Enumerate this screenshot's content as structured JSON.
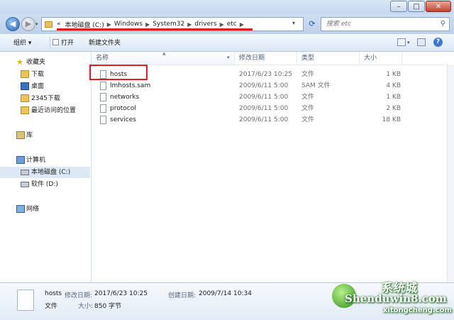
{
  "address": {
    "overflow": "«",
    "segments": [
      "本地磁盘 (C:)",
      "Windows",
      "System32",
      "drivers",
      "etc"
    ]
  },
  "search": {
    "placeholder": "搜索 etc"
  },
  "toolbar": {
    "organize": "组织 ▾",
    "open": "打开",
    "new_folder": "新建文件夹"
  },
  "nav": {
    "favorites": "收藏夹",
    "fav_items": [
      "下载",
      "桌面",
      "2345下载",
      "最近访问的位置"
    ],
    "library": "库",
    "computer": "计算机",
    "drives": [
      "本地磁盘 (C:)",
      "软件 (D:)"
    ],
    "network": "网络"
  },
  "columns": {
    "name": "名称",
    "date": "修改日期",
    "type": "类型",
    "size": "大小"
  },
  "files": [
    {
      "name": "hosts",
      "date": "2017/6/23 10:25",
      "type": "文件",
      "size": "1 KB"
    },
    {
      "name": "lmhosts.sam",
      "date": "2009/6/11 5:00",
      "type": "SAM 文件",
      "size": "4 KB"
    },
    {
      "name": "networks",
      "date": "2009/6/11 5:00",
      "type": "文件",
      "size": "1 KB"
    },
    {
      "name": "protocol",
      "date": "2009/6/11 5:00",
      "type": "文件",
      "size": "2 KB"
    },
    {
      "name": "services",
      "date": "2009/6/11 5:00",
      "type": "文件",
      "size": "18 KB"
    }
  ],
  "details": {
    "name": "hosts",
    "modified_label": "修改日期:",
    "modified": "2017/6/23 10:25",
    "created_label": "创建日期:",
    "created": "2009/7/14 10:34",
    "type": "文件",
    "size_label": "大小:",
    "size": "850 字节"
  },
  "watermark": {
    "line1": "Shenduwin8.com",
    "line2": "xitongcheng.com",
    "logo_text": "系统城"
  },
  "colors": {
    "highlight": "#e02020",
    "chrome": "#c6d8ef",
    "accent": "#2b62b3"
  }
}
